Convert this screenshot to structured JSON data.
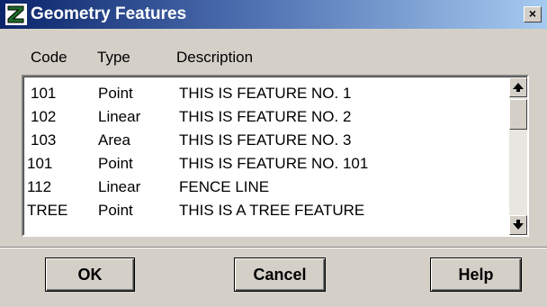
{
  "window": {
    "title": "Geometry Features",
    "close_label": "×"
  },
  "columns": {
    "code": "Code",
    "type": "Type",
    "description": "Description"
  },
  "rows": [
    {
      "code": "101",
      "type": "Point",
      "description": "THIS IS FEATURE NO. 1"
    },
    {
      "code": "102",
      "type": "Linear",
      "description": "THIS IS FEATURE NO. 2"
    },
    {
      "code": "103",
      "type": "Area",
      "description": "THIS IS FEATURE NO. 3"
    },
    {
      "code": "101",
      "type": "Point",
      "description": "THIS IS FEATURE NO. 101"
    },
    {
      "code": "112",
      "type": "Linear",
      "description": "FENCE LINE"
    },
    {
      "code": "TREE",
      "type": "Point",
      "description": "THIS IS A TREE FEATURE"
    }
  ],
  "buttons": {
    "ok": "OK",
    "cancel": "Cancel",
    "help": "Help"
  },
  "colors": {
    "title_start": "#0a246a",
    "title_end": "#a6caf0",
    "face": "#d4d0c8"
  }
}
